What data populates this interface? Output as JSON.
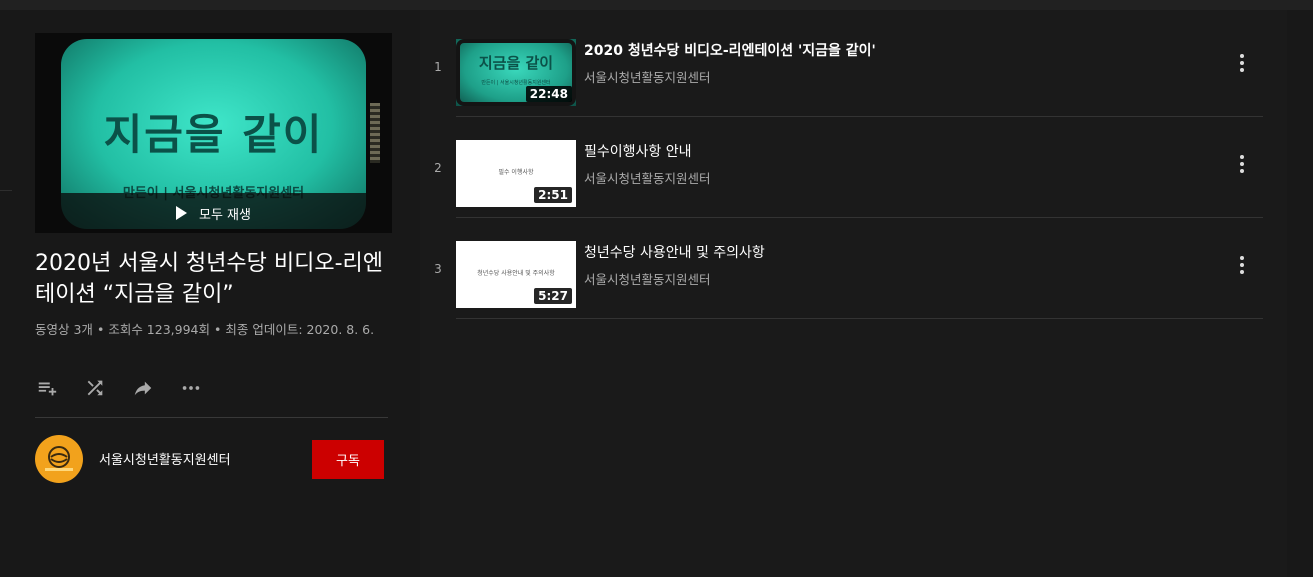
{
  "hero": {
    "thumb_title": "지금을 같이",
    "thumb_subtitle": "만든이 | 서울시청년활동지원센터",
    "play_all_label": "모두 재생"
  },
  "playlist": {
    "title": "2020년 서울시 청년수당 비디오-리엔테이션 “지금을 같이”",
    "video_count": "동영상 3개",
    "view_count": "조회수 123,994회",
    "updated": "최종 업데이트: 2020. 8. 6.",
    "separator": "•"
  },
  "actions": {
    "icons": [
      "add-to-queue-icon",
      "shuffle-icon",
      "share-icon",
      "more-horizontal-icon"
    ]
  },
  "owner": {
    "name": "서울시청년활동지원센터",
    "subscribe_label": "구독",
    "avatar_color": "#f2a21c"
  },
  "videos": [
    {
      "index": "1",
      "title": "2020 청년수당 비디오-리엔테이션 '지금을 같이'",
      "channel": "서울시청년활동지원센터",
      "duration": "22:48",
      "thumb_text": "지금을 같이",
      "thumb_sub": "만든이 | 서울시청년활동지원센터"
    },
    {
      "index": "2",
      "title": "필수이행사항 안내",
      "channel": "서울시청년활동지원센터",
      "duration": "2:51",
      "thumb_text": "필수 이행사항"
    },
    {
      "index": "3",
      "title": "청년수당 사용안내 및 주의사항",
      "channel": "서울시청년활동지원센터",
      "duration": "5:27",
      "thumb_text": "청년수당 사용안내 및 주의사항"
    }
  ],
  "colors": {
    "background": "#181818",
    "panel": "#1a1a1a",
    "subscribe_red": "#cc0000",
    "secondary_text": "#aaaaaa"
  }
}
